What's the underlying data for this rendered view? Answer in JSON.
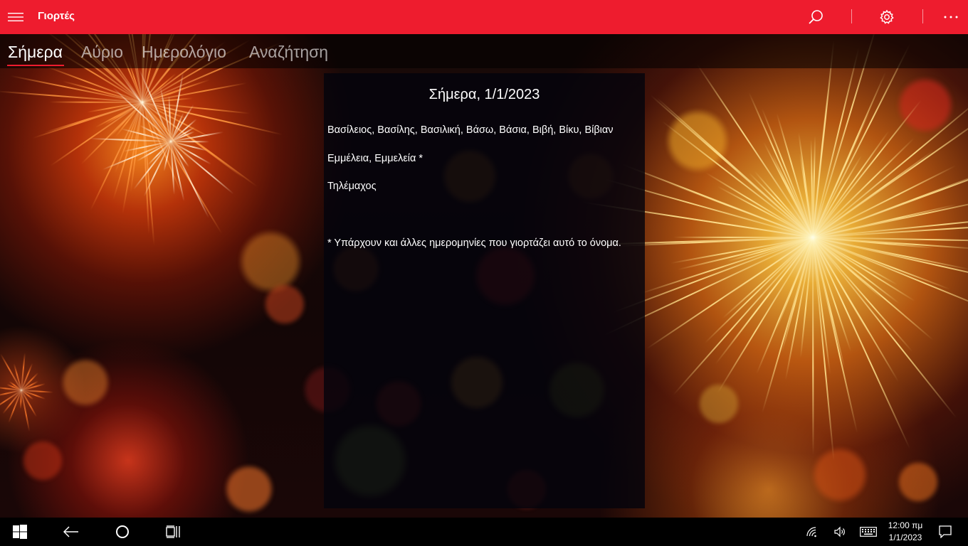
{
  "app": {
    "title": "Γιορτές"
  },
  "tabs": [
    {
      "label": "Σήμερα",
      "active": true
    },
    {
      "label": "Αύριο",
      "active": false
    },
    {
      "label": "Ημερολόγιο",
      "active": false
    },
    {
      "label": "Αναζήτηση",
      "active": false
    }
  ],
  "content": {
    "heading": "Σήμερα, 1/1/2023",
    "names": [
      "Βασίλειος, Βασίλης, Βασιλική, Βάσω, Βάσια, Βιβή, Βίκυ, Βίβιαν",
      "Εμμέλεια, Εμμελεία *",
      "Τηλέμαχος"
    ],
    "footnote": "* Υπάρχουν και άλλες ημερομηνίες που γιορτάζει αυτό το όνομα."
  },
  "toolbar": {
    "icons": [
      "search-icon",
      "settings-icon",
      "more-icon"
    ]
  },
  "taskbar": {
    "time": "12:00 πμ",
    "date": "1/1/2023"
  },
  "colors": {
    "accent": "#ee1c2e",
    "panel": "#04040c"
  }
}
